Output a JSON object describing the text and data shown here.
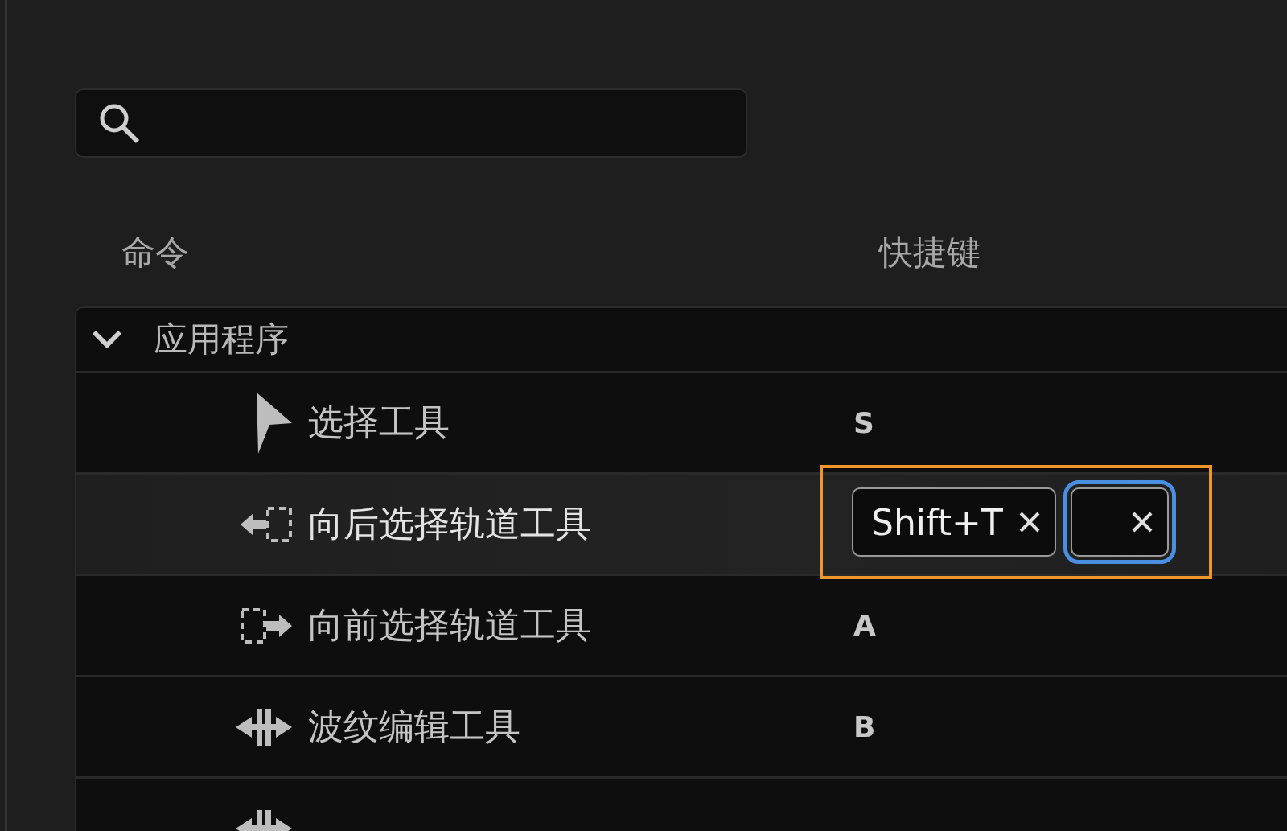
{
  "columns": [
    "命令",
    "快捷键"
  ],
  "group": {
    "label": "应用程序",
    "expanded": true,
    "rows": [
      {
        "label": "选择工具",
        "selected": false,
        "kind": "text",
        "shortcut": "S"
      },
      {
        "label": "向后选择轨道工具",
        "selected": true,
        "kind": "editor",
        "highlighted": true,
        "chips": [
          {
            "label": "Shift+T",
            "focused": false
          },
          {
            "focused": true
          }
        ]
      },
      {
        "label": "向前选择轨道工具",
        "selected": false,
        "kind": "text",
        "shortcut": "A"
      },
      {
        "label": "波纹编辑工具",
        "selected": false,
        "kind": "text",
        "shortcut": "B"
      },
      {
        "selected": false,
        "kind": "text"
      }
    ]
  }
}
